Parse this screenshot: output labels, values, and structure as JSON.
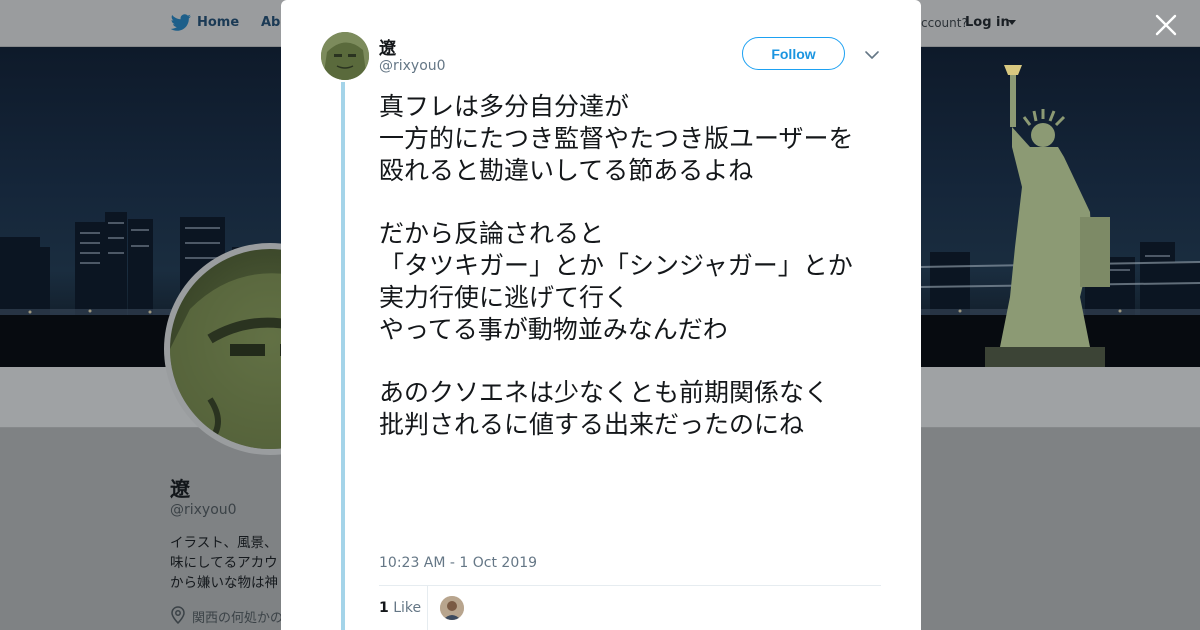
{
  "nav": {
    "home_label": "Home",
    "about_label": "Abo",
    "account_prompt": "ccount?",
    "login_label": "Log in"
  },
  "profile": {
    "name": "遼",
    "handle": "@rixyou0",
    "bio": "イラスト、風景、味にしてるアカウから嫌いな物は神",
    "location": "関西の何処かの"
  },
  "tweet": {
    "author_name": "遼",
    "author_handle": "@rixyou0",
    "follow_label": "Follow",
    "text": "真フレは多分自分達が\n一方的にたつき監督やたつき版ユーザーを\n殴れると勘違いしてる節あるよね\n\nだから反論されると\n「タツキガー」とか「シンジャガー」とか\n実力行使に逃げて行く\nやってる事が動物並みなんだわ\n\nあのクソエネは少なくとも前期関係なく\n批判されるに値する出来だったのにね",
    "timestamp": "10:23 AM - 1 Oct 2019",
    "like_count": "1",
    "like_label": "Like"
  },
  "colors": {
    "accent": "#1da1f2",
    "thread_line": "#a4d4e9",
    "text_primary": "#14171a",
    "text_secondary": "#657786"
  },
  "icons": {
    "nav": "twitter-bird-icon",
    "close": "close-icon",
    "more": "chevron-down-icon",
    "location": "location-pin-icon"
  }
}
